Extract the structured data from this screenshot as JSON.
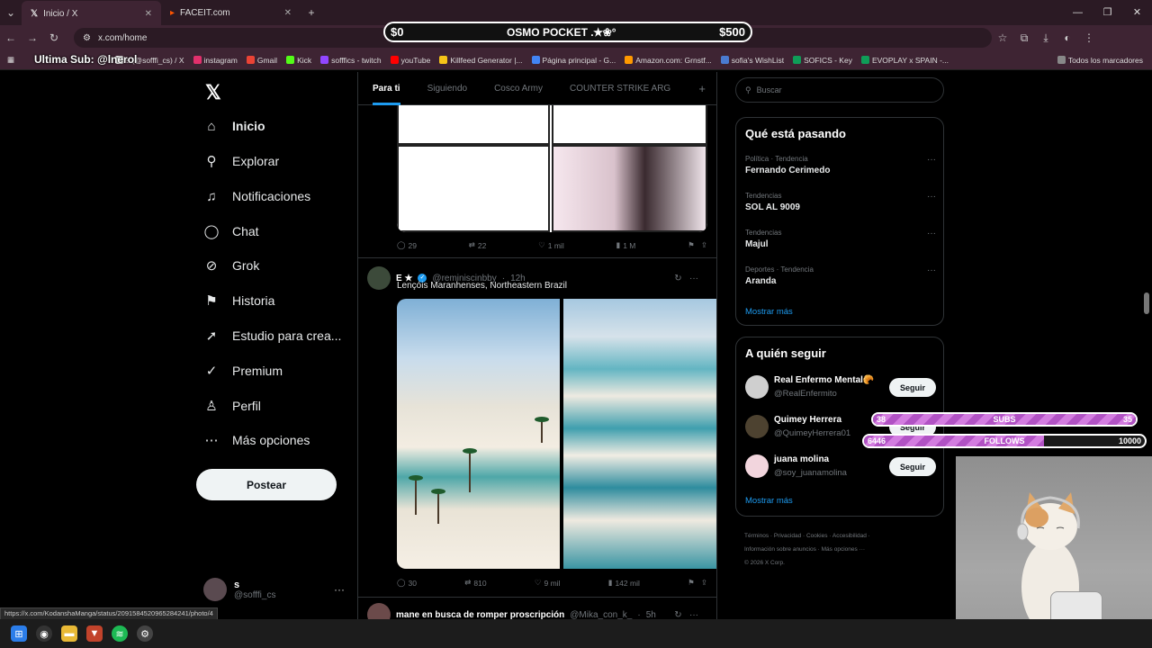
{
  "browser": {
    "tabs": [
      {
        "title": "Inicio / X",
        "active": true
      },
      {
        "title": "FACEIT.com",
        "active": false
      }
    ],
    "url": "x.com/home",
    "bookmarks": [
      {
        "label": "s (@sofffi_cs) / X",
        "color": "#ffffff"
      },
      {
        "label": "instagram",
        "color": "#e1306c"
      },
      {
        "label": "Gmail",
        "color": "#ea4335"
      },
      {
        "label": "Kick",
        "color": "#53fc18"
      },
      {
        "label": "sofffics - twitch",
        "color": "#9146ff"
      },
      {
        "label": "youTube",
        "color": "#ff0000"
      },
      {
        "label": "Killfeed Generator |...",
        "color": "#f5c518"
      },
      {
        "label": "Página principal - G...",
        "color": "#4285f4"
      },
      {
        "label": "Amazon.com: Grnstf...",
        "color": "#ff9900"
      },
      {
        "label": "sofia's WishList",
        "color": "#4a7bd0"
      },
      {
        "label": "SOFICS - Key",
        "color": "#0f9d58"
      },
      {
        "label": "EVOPLAY x SPAIN -...",
        "color": "#0f9d58"
      }
    ],
    "all_bookmarks": "Todos los marcadores",
    "status_url": "https://x.com/KodanshaManga/status/2091584520965284241/photo/4"
  },
  "overlay": {
    "banner_left": "$0",
    "banner_mid": "OSMO POCKET .✭❀°",
    "banner_right": "$500",
    "last_sub": "Ultima Sub: @lnerol",
    "subs": {
      "label": "SUBS",
      "current": "38",
      "goal": "35",
      "fill": 1.0
    },
    "follows": {
      "label": "FOLLOWS",
      "current": "6446",
      "goal": "10000",
      "fill": 0.64
    }
  },
  "nav": {
    "items": [
      {
        "label": "Inicio",
        "icon": "home-icon",
        "glyph": "⌂"
      },
      {
        "label": "Explorar",
        "icon": "search-icon",
        "glyph": "⚲"
      },
      {
        "label": "Notificaciones",
        "icon": "bell-icon",
        "glyph": "🔔"
      },
      {
        "label": "Chat",
        "icon": "chat-icon",
        "glyph": "◯"
      },
      {
        "label": "Grok",
        "icon": "grok-icon",
        "glyph": "⊘"
      },
      {
        "label": "Historia",
        "icon": "bookmark-icon",
        "glyph": "⚑"
      },
      {
        "label": "Estudio para crea...",
        "icon": "rocket-icon",
        "glyph": "➚"
      },
      {
        "label": "Premium",
        "icon": "verified-icon",
        "glyph": "✓"
      },
      {
        "label": "Perfil",
        "icon": "person-icon",
        "glyph": "♙"
      },
      {
        "label": "Más opciones",
        "icon": "more-circle-icon",
        "glyph": "⋯"
      }
    ],
    "post_button": "Postear",
    "profile_name": "s",
    "profile_handle": "@sofffi_cs"
  },
  "timeline": {
    "tabs": [
      "Para ti",
      "Siguiendo",
      "Cosco Army",
      "COUNTER STRIKE ARG"
    ],
    "tweet1_stats": {
      "replies": "29",
      "reposts": "22",
      "likes": "1 mil",
      "views": "1 M"
    },
    "tweet2": {
      "name": "E ★",
      "handle": "@reminiscinbby",
      "time": "12h",
      "text": "Lençóis Maranhenses, Northeastern Brazil",
      "stats": {
        "replies": "30",
        "reposts": "810",
        "likes": "9 mil",
        "views": "142 mil"
      }
    },
    "tweet3": {
      "name": "mane en busca de romper proscripción",
      "handle": "@Mika_con_k_",
      "time": "5h"
    }
  },
  "sidebar": {
    "search_placeholder": "Buscar",
    "trends_title": "Qué está pasando",
    "trends": [
      {
        "meta": "Política · Tendencia",
        "title": "Fernando Cerimedo"
      },
      {
        "meta": "Tendencias",
        "title": "SOL AL 9009"
      },
      {
        "meta": "Tendencias",
        "title": "Majul"
      },
      {
        "meta": "Deportes · Tendencia",
        "title": "Aranda"
      }
    ],
    "show_more": "Mostrar más",
    "follow_title": "A quién seguir",
    "follow": [
      {
        "name": "Real Enfermo Mental🥐",
        "handle": "@RealEnfermito",
        "button": "Seguir"
      },
      {
        "name": "Quimey Herrera",
        "handle": "@QuimeyHerrera01",
        "button": "Seguir"
      },
      {
        "name": "juana molina",
        "handle": "@soy_juanamolina",
        "button": "Seguir"
      }
    ],
    "footer_line1": "Términos · Privacidad · Cookies · Accesibilidad ·",
    "footer_line2": "Información sobre anuncios · Más opciones ···",
    "footer_line3": "© 2026 X Corp."
  }
}
